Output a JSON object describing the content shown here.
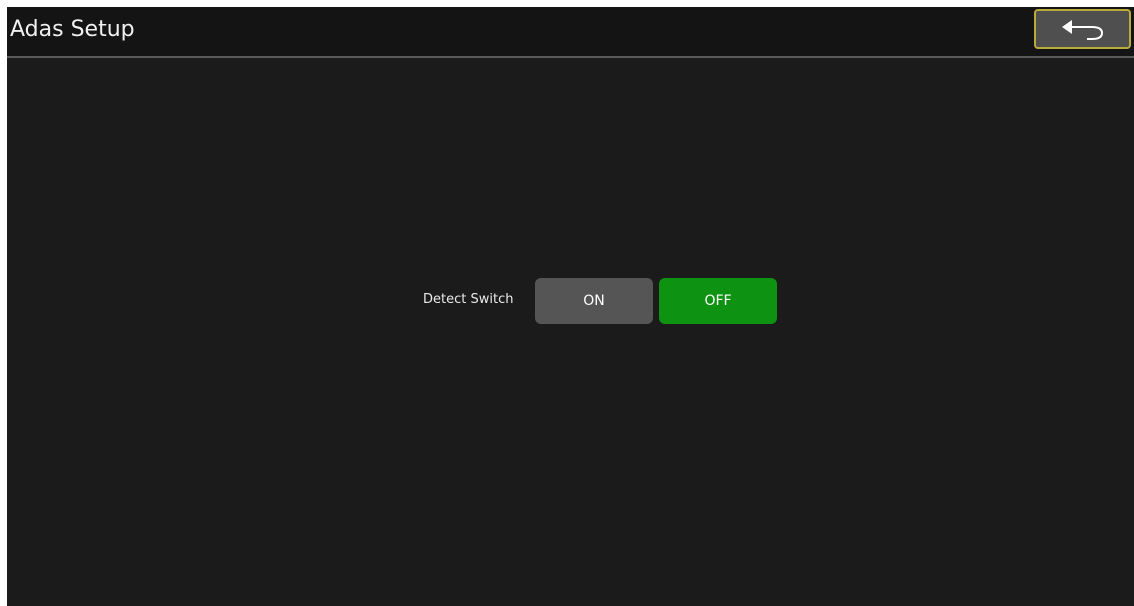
{
  "header": {
    "title": "Adas Setup",
    "back_icon": "back-arrow-icon"
  },
  "settings": {
    "detect_switch": {
      "label": "Detect Switch",
      "on_label": "ON",
      "off_label": "OFF",
      "selected": "OFF"
    }
  },
  "colors": {
    "background": "#1b1b1b",
    "header_background": "#141414",
    "selected_button": "#0e9212",
    "unselected_button": "#555555",
    "back_button_border": "#b8ab3a"
  }
}
